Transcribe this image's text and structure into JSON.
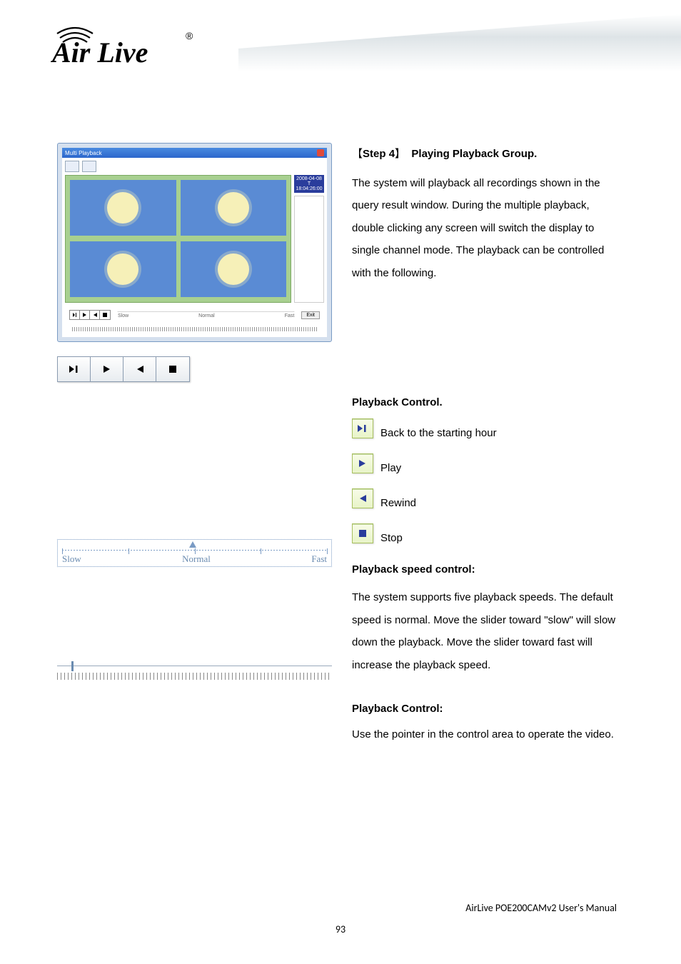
{
  "logo_text": "Air Live",
  "logo_reg": "®",
  "screenshot": {
    "window_title": "Multi Playback",
    "timestamp_line1": "2008-04-08 T",
    "timestamp_line2": "18:04:26:00",
    "speed_labels": {
      "slow": "Slow",
      "normal": "Normal",
      "fast": "Fast"
    },
    "exit_label": "Exit"
  },
  "step": {
    "bracket_open": "【",
    "label": "Step 4",
    "bracket_close": "】",
    "title": "Playing Playback Group."
  },
  "para1": "The system will playback all recordings shown in the query result window. During the multiple playback, double clicking any screen will switch the display to single channel mode. The playback can be controlled with the following.",
  "playback_control": {
    "heading": "Playback Control.",
    "back_label": "Back to the starting hour",
    "play_label": "Play",
    "rewind_label": "Rewind",
    "stop_label": "Stop"
  },
  "speed_control": {
    "heading": "Playback speed control:",
    "slider_labels": {
      "slow": "Slow",
      "normal": "Normal",
      "fast": "Fast"
    },
    "body": "The system supports five playback speeds. The default speed is normal. Move the slider toward \"slow\" will slow down the playback. Move the slider toward fast will increase the playback speed."
  },
  "playback_control2": {
    "heading": "Playback Control:",
    "body": "Use the pointer in the control area to operate the video."
  },
  "footer": {
    "product": "AirLive POE200CAMv2 User's Manual",
    "page": "93"
  }
}
